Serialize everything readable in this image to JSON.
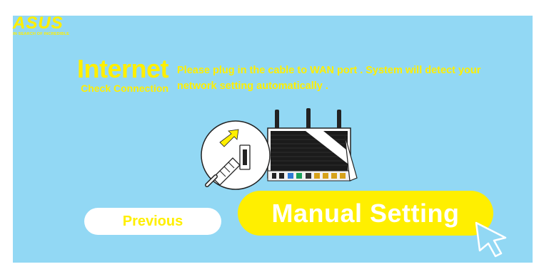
{
  "brand": {
    "name": "ASUS",
    "tagline": "IN SEARCH OF INCREDIBLE"
  },
  "heading": {
    "title": "Internet",
    "subtitle": "Check Connection"
  },
  "instructions": "Please plug in the cable to WAN port . System will detect your network setting automatically .",
  "buttons": {
    "previous": "Previous",
    "manual": "Manual Setting"
  },
  "icons": {
    "router": "router-illustration-icon",
    "cable": "ethernet-cable-icon",
    "cursor": "mouse-cursor-icon"
  },
  "colors": {
    "background": "#92d8f4",
    "accent": "#ffef00",
    "button_light": "#ffffff"
  }
}
